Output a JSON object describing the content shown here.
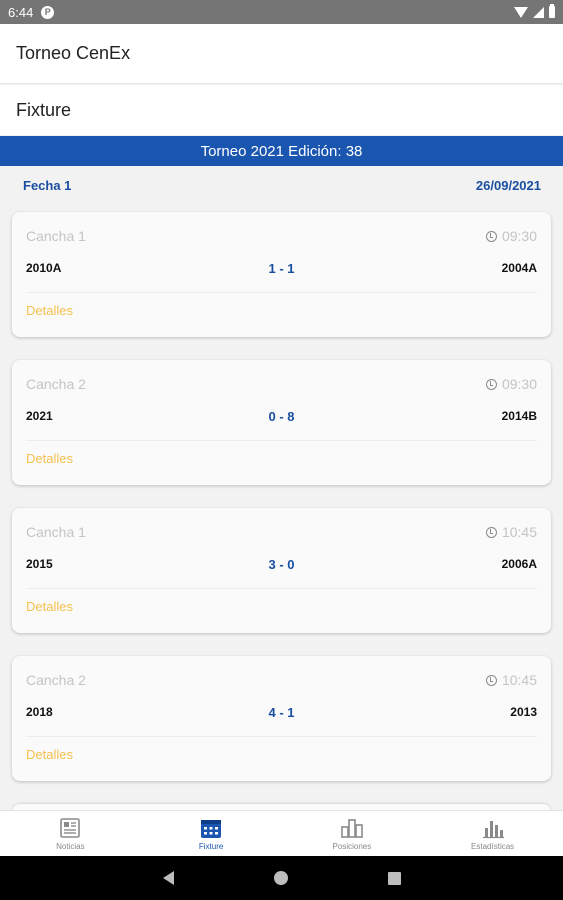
{
  "status_bar": {
    "time": "6:44",
    "notification_icon": "P"
  },
  "app_title": "Torneo CenEx",
  "section_title": "Fixture",
  "banner": "Torneo 2021 Edición: 38",
  "round": {
    "label": "Fecha 1",
    "date": "26/09/2021"
  },
  "matches": [
    {
      "field": "Cancha 1",
      "time": "09:30",
      "home": "2010A",
      "score": "1 - 1",
      "away": "2004A",
      "details": "Detalles"
    },
    {
      "field": "Cancha 2",
      "time": "09:30",
      "home": "2021",
      "score": "0 - 8",
      "away": "2014B",
      "details": "Detalles"
    },
    {
      "field": "Cancha 1",
      "time": "10:45",
      "home": "2015",
      "score": "3 - 0",
      "away": "2006A",
      "details": "Detalles"
    },
    {
      "field": "Cancha 2",
      "time": "10:45",
      "home": "2018",
      "score": "4 - 1",
      "away": "2013",
      "details": "Detalles"
    }
  ],
  "bottom_nav": [
    {
      "label": "Noticias",
      "icon": "newspaper-icon",
      "active": false
    },
    {
      "label": "Fixture",
      "icon": "calendar-icon",
      "active": true
    },
    {
      "label": "Posiciones",
      "icon": "podium-icon",
      "active": false
    },
    {
      "label": "Estadísticas",
      "icon": "bar-chart-icon",
      "active": false
    }
  ],
  "colors": {
    "primary": "#1a56b0",
    "accent": "#f5c04e",
    "status_bar": "#757575"
  }
}
